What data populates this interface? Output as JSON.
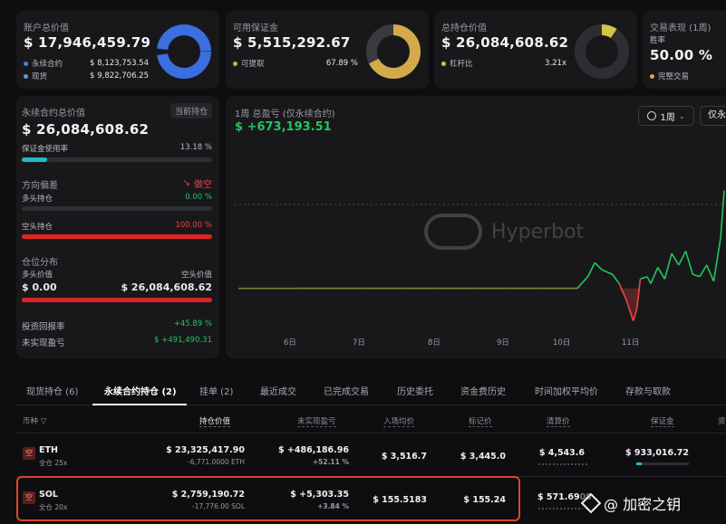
{
  "top_cards": {
    "account": {
      "label": "账户总价值",
      "value": "$ 17,946,459.79",
      "legend": [
        {
          "name": "永续合约",
          "value": "$ 8,123,753.54",
          "color": "#3b82f6"
        },
        {
          "name": "现货",
          "value": "$ 9,822,706.25",
          "color": "#6e96e0"
        }
      ]
    },
    "margin": {
      "label": "可用保证金",
      "value": "$ 5,515,292.67",
      "legend_name": "可提取",
      "legend_value": "67.89 %",
      "color": "#d4a94a",
      "percent": 67.89
    },
    "position": {
      "label": "总持仓价值",
      "value": "$ 26,084,608.62",
      "legend_name": "杠杆比",
      "legend_value": "3.21x",
      "color": "#d4c24a"
    },
    "performance": {
      "label": "交易表现 (1周)",
      "sub": "胜率",
      "value": "50.00 %",
      "legend_name": "完整交易",
      "color": "#d4a94a"
    }
  },
  "perp_panel": {
    "label": "永续合约总价值",
    "badge": "当前持仓",
    "value": "$ 26,084,608.62",
    "margin_usage_label": "保证金使用率",
    "margin_usage_value": "13.18 %",
    "margin_usage_pct": 13.18,
    "direction_label": "方向偏差",
    "direction_value": "做空",
    "long_label": "多头持仓",
    "long_value": "0.00 %",
    "long_pct": 0,
    "short_label": "空头持仓",
    "short_value": "100.00 %",
    "short_pct": 100,
    "distribution_label": "仓位分布",
    "long_value_label": "多头价值",
    "short_value_label": "空头价值",
    "long_amount": "$ 0.00",
    "short_amount": "$ 26,084,608.62",
    "roi_label": "投资回报率",
    "roi_value": "+45.89 %",
    "unrealized_label": "未实现盈亏",
    "unrealized_value": "$ +491,490.31"
  },
  "chart_panel": {
    "title": "1周 总盈亏 (仅永续合约)",
    "value": "$ +673,193.51",
    "period_button": "1周",
    "filter_button": "仅永",
    "watermark": "Hyperbot"
  },
  "chart_data": {
    "type": "line",
    "title": "1周 总盈亏 (仅永续合约)",
    "x_ticks": [
      "6日",
      "7日",
      "8日",
      "9日",
      "10日",
      "11日"
    ],
    "x": [
      0,
      0.5,
      1,
      1.5,
      2,
      2.5,
      3,
      3.5,
      4,
      4.15,
      4.25,
      4.35,
      4.5,
      4.6,
      4.7,
      4.8,
      4.85,
      4.9,
      5.0,
      5.05,
      5.15,
      5.25,
      5.35,
      5.45,
      5.55,
      5.65,
      5.75,
      5.85,
      5.95,
      6.05,
      6.1
    ],
    "values": [
      0,
      0,
      0,
      0,
      0,
      0,
      0,
      0,
      0,
      25000,
      55000,
      40000,
      30000,
      10000,
      -25000,
      -70000,
      -45000,
      20000,
      25000,
      10000,
      45000,
      20000,
      75000,
      50000,
      80000,
      30000,
      25000,
      50000,
      15000,
      110000,
      210000
    ],
    "ylim": [
      -100000,
      250000
    ],
    "baseline": 0,
    "colors": {
      "positive": "#22c55e",
      "negative": "#ef4444",
      "flat": "#7a8a3a"
    }
  },
  "tabs": [
    {
      "label": "现货持仓 (6)",
      "active": false
    },
    {
      "label": "永续合约持仓 (2)",
      "active": true
    },
    {
      "label": "挂单 (2)",
      "active": false
    },
    {
      "label": "最近成交",
      "active": false
    },
    {
      "label": "已完成交易",
      "active": false
    },
    {
      "label": "历史委托",
      "active": false
    },
    {
      "label": "资金费历史",
      "active": false
    },
    {
      "label": "时间加权平均价",
      "active": false
    },
    {
      "label": "存款与取款",
      "active": false
    }
  ],
  "table": {
    "headers": [
      "币种",
      "持仓价值",
      "未实现盈亏",
      "入场均价",
      "标记价",
      "清算价",
      "保证金",
      "资"
    ],
    "rows": [
      {
        "side": "空",
        "coin": "ETH",
        "mode": "全仓 25x",
        "value": "$ 23,325,417.90",
        "size": "-6,771.0000 ETH",
        "pnl": "$ +486,186.96",
        "pnl_pct": "+52.11 %",
        "entry": "$ 3,516.7",
        "mark": "$ 3,445.0",
        "liq": "$ 4,543.6",
        "margin": "$ 933,016.72"
      },
      {
        "side": "空",
        "coin": "SOL",
        "mode": "全仓 20x",
        "value": "$ 2,759,190.72",
        "size": "-17,776.00 SOL",
        "pnl": "$ +5,303.35",
        "pnl_pct": "+3.84 %",
        "entry": "$ 155.5183",
        "mark": "$ 155.24",
        "liq": "$ 571.6908"
      }
    ]
  },
  "watermark_badge": "@ 加密之钥"
}
